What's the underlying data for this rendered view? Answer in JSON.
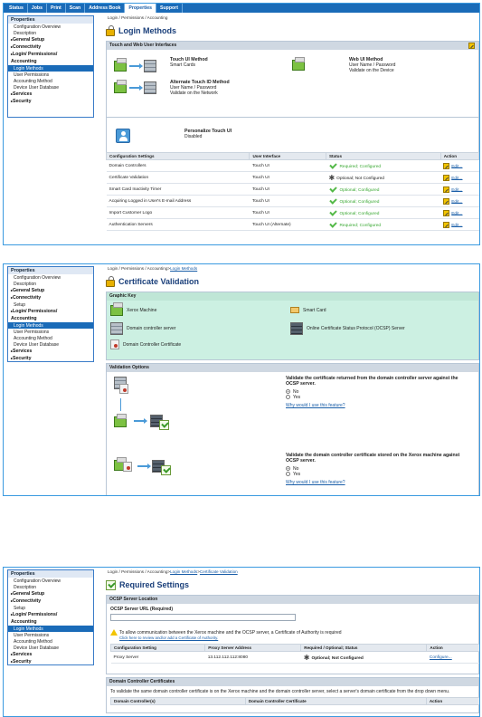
{
  "tabs": [
    "Status",
    "Jobs",
    "Print",
    "Scan",
    "Address Book",
    "Properties",
    "Support"
  ],
  "active_tab": "Properties",
  "sidebar": {
    "title": "Properties",
    "items": [
      {
        "label": "Configuration Overview",
        "type": "item"
      },
      {
        "label": "Description",
        "type": "item"
      },
      {
        "label": "General Setup",
        "type": "group"
      },
      {
        "label": "Connectivity",
        "type": "group"
      },
      {
        "label": "Login/ Permissions/",
        "type": "group"
      },
      {
        "label": "Accounting",
        "type": "group-cont"
      },
      {
        "label": "Login Methods",
        "type": "item",
        "selected": true
      },
      {
        "label": "User Permissions",
        "type": "item"
      },
      {
        "label": "Accounting Method",
        "type": "item"
      },
      {
        "label": "Device User Database",
        "type": "item"
      },
      {
        "label": "Services",
        "type": "group"
      },
      {
        "label": "Security",
        "type": "group"
      }
    ],
    "setup_label": "Setup"
  },
  "screen1": {
    "breadcrumb": "Login / Permissions / Accounting",
    "title": "Login Methods",
    "section_title": "Touch and Web User Interfaces",
    "touch_ui_title": "Touch UI Method",
    "touch_ui_value": "Smart Cards",
    "web_ui_title": "Web UI Method",
    "web_ui_line1": "User Name / Password",
    "web_ui_line2": "Validate on the Device",
    "alt_title": "Alternate Touch ID Method",
    "alt_line1": "User Name / Password",
    "alt_line2": "Validate on the Network",
    "personalize_title": "Personalize Touch UI",
    "personalize_value": "Disabled",
    "table_headers": [
      "Configuration Settings",
      "User Interface",
      "Status",
      "Action"
    ],
    "rows": [
      {
        "setting": "Domain Controllers",
        "ui": "Touch UI",
        "status": "Required; Configured",
        "status_type": "ok",
        "action": "Edit..."
      },
      {
        "setting": "Certificate Validation",
        "ui": "Touch UI",
        "status": "Optional; Not Configured",
        "status_type": "gear",
        "action": "Edit..."
      },
      {
        "setting": "Smart Card Inactivity Timer",
        "ui": "Touch UI",
        "status": "Optional; Configured",
        "status_type": "ok",
        "action": "Edit..."
      },
      {
        "setting": "Acquiring Logged in User's E-mail Address",
        "ui": "Touch UI",
        "status": "Optional; Configured",
        "status_type": "ok",
        "action": "Edit..."
      },
      {
        "setting": "Import Customer Logo",
        "ui": "Touch UI",
        "status": "Optional; Configured",
        "status_type": "ok",
        "action": "Edit..."
      },
      {
        "setting": "Authentication Servers",
        "ui": "Touch UI (Alternate)",
        "status": "Required; Configured",
        "status_type": "ok",
        "action": "Edit..."
      }
    ]
  },
  "screen2": {
    "breadcrumb_prefix": "Login / Permissions / Accounting>",
    "breadcrumb_link": "Login Methods",
    "title": "Certificate Validation",
    "graphic_key_title": "Graphic Key",
    "key": {
      "xerox": "Xerox Machine",
      "smart_card": "Smart Card",
      "dc_server": "Domain controller server",
      "ocsp": "Online Certificate Status Protocol (OCSP) Server",
      "dc_cert": "Domain Controller Certificate"
    },
    "validation_title": "Validation Options",
    "q1": "Validate the certificate returned from the domain controller server against the OCSP server.",
    "q1_options": [
      "No",
      "Yes"
    ],
    "q1_selected": "No",
    "q1_link": "Why would I use this feature?",
    "q2": "Validate the domain controller certificate stored on the Xerox machine against OCSP server.",
    "q2_options": [
      "No",
      "Yes"
    ],
    "q2_selected": "No",
    "q2_link": "Why would I use this feature?"
  },
  "screen3": {
    "breadcrumb_prefix": "Login / Permissions / Accounting>",
    "breadcrumb_link1": "Login Methods",
    "breadcrumb_sep": ">",
    "breadcrumb_link2": "Certificate Validation",
    "title": "Required Settings",
    "ocsp_section": "OCSP Server Location",
    "ocsp_url_label": "OCSP Server URL (Required)",
    "warning_text": "To allow communication between the Xerox machine and the OCSP server, a Certificate of Authority is required",
    "warning_link": "Click here to review and/or add a Certificate of Authority.",
    "table_headers": [
      "Configuration Setting",
      "Proxy Server Address",
      "Required / Optional; Status",
      "Action"
    ],
    "row": {
      "setting": "Proxy Server",
      "address": "13.112.112.112:8080",
      "status": "Optional; Not Configured",
      "action": "Configure..."
    },
    "dc_section": "Domain Controller Certificates",
    "dc_text": "To validate the same domain controller certificate is on the Xerox machine and the domain controller server, select a server's domain certificate from the drop down menu.",
    "dc_headers": [
      "Domain Controller(s)",
      "Domain Controller Certificate",
      "Action"
    ]
  }
}
